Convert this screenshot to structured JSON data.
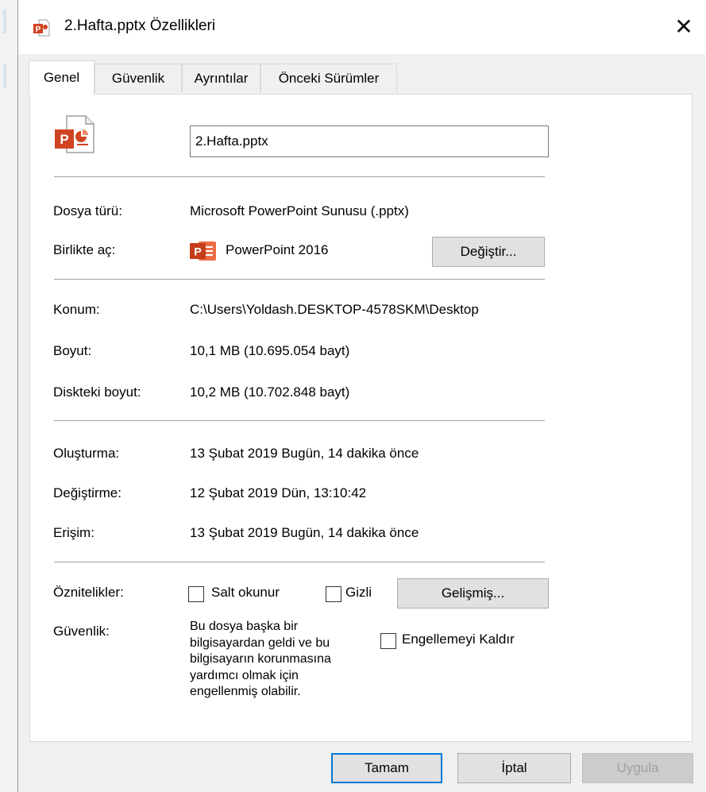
{
  "window": {
    "title": "2.Hafta.pptx Özellikleri",
    "close_glyph": "✕"
  },
  "tabs": [
    {
      "label": "Genel"
    },
    {
      "label": "Güvenlik"
    },
    {
      "label": "Ayrıntılar"
    },
    {
      "label": "Önceki Sürümler"
    }
  ],
  "general": {
    "file_name": "2.Hafta.pptx",
    "file_type": {
      "label": "Dosya türü:",
      "value": "Microsoft PowerPoint Sunusu (.pptx)"
    },
    "open_with": {
      "label": "Birlikte aç:",
      "value": "PowerPoint 2016",
      "change_button": "Değiştir..."
    },
    "location": {
      "label": "Konum:",
      "value": "C:\\Users\\Yoldash.DESKTOP-4578SKM\\Desktop"
    },
    "size": {
      "label": "Boyut:",
      "value": "10,1 MB (10.695.054 bayt)"
    },
    "disk_size": {
      "label": "Diskteki boyut:",
      "value": "10,2 MB (10.702.848 bayt)"
    },
    "created": {
      "label": "Oluşturma:",
      "value": "13 Şubat 2019 Bugün, 14 dakika önce"
    },
    "modified": {
      "label": "Değiştirme:",
      "value": "12 Şubat 2019 Dün, 13:10:42"
    },
    "accessed": {
      "label": "Erişim:",
      "value": "13 Şubat 2019 Bugün, 14 dakika önce"
    },
    "attributes": {
      "label": "Öznitelikler:",
      "readonly_label": "Salt okunur",
      "readonly_checked": false,
      "hidden_label": "Gizli",
      "hidden_checked": false,
      "advanced_button": "Gelişmiş..."
    },
    "security": {
      "label": "Güvenlik:",
      "text": "Bu dosya başka bir\nbilgisayardan geldi ve bu\nbilgisayarın korunmasına\nyardımcı olmak için\nengellenmiş olabilir.",
      "unblock_label": "Engellemeyi Kaldır",
      "unblock_checked": false
    }
  },
  "footer": {
    "ok": "Tamam",
    "cancel": "İptal",
    "apply": "Uygula"
  },
  "colors": {
    "accent": "#0078d7",
    "powerpoint": "#d04423"
  }
}
